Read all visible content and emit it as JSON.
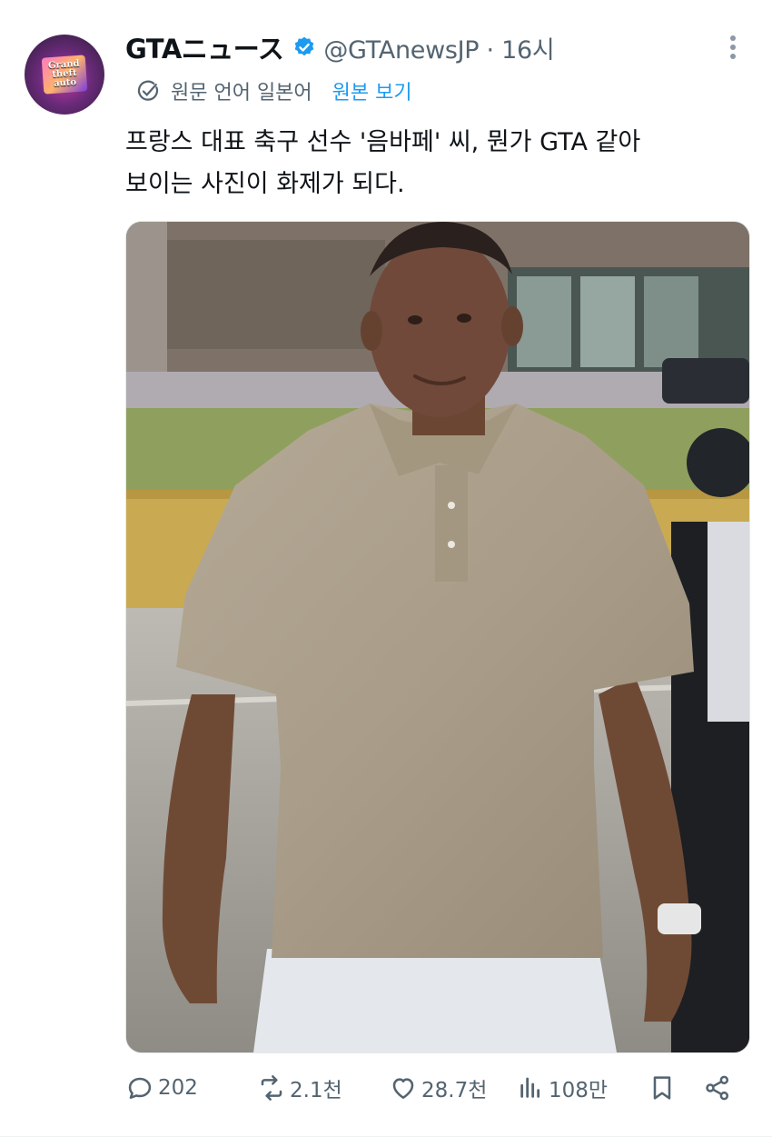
{
  "tweet": {
    "display_name": "GTAニュース",
    "handle_time": "@GTAnewsJP · 16시",
    "translation": {
      "label": "원문 언어 일본어",
      "show_original": "원본 보기"
    },
    "text_lines": [
      "프랑스 대표 축구 선수 '음바페' 씨, 뭔가 GTA 같아",
      "보이는 사진이 화제가 되다."
    ],
    "avatar_logo": [
      "Grand",
      "theft",
      "auto"
    ]
  },
  "actions": {
    "replies": "202",
    "retweets": "2.1천",
    "likes": "28.7천",
    "views": "108만"
  },
  "icons": {
    "verified": "verified-badge-icon",
    "more": "more-icon",
    "translate": "translate-icon",
    "reply": "reply-icon",
    "retweet": "retweet-icon",
    "like": "like-icon",
    "views": "views-icon",
    "bookmark": "bookmark-icon",
    "share": "share-icon"
  },
  "colors": {
    "link": "#1d9bf0",
    "secondary_text": "#536471",
    "verified": "#1d9bf0"
  }
}
